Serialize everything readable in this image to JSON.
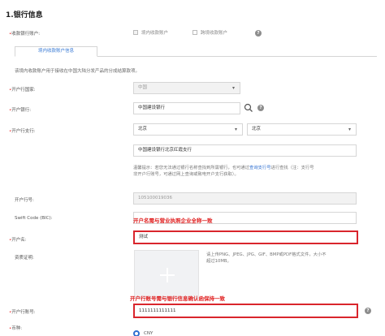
{
  "section_title": "1.银行信息",
  "account_type": {
    "label": "收款银行账户:",
    "option1": "境内收款账户",
    "option2": "跨境收款账户"
  },
  "tab": {
    "label": "境内收款账户信息"
  },
  "intro": "该境内收款账户用于接收在中国大陆分发产品的分成结算款项。",
  "country": {
    "label": "开户行国家:",
    "value": "中国"
  },
  "bank": {
    "label": "开户银行:",
    "value": "中国建设银行"
  },
  "branch": {
    "label": "开户行支行:",
    "province": "北京",
    "city": "北京",
    "value": "中国建设银行北京红霞支行",
    "tip_line1_a": "温馨提示：若您无法通过银行名称查找到所需银行，也可通过",
    "tip_link": "查询支行号",
    "tip_line1_b": "进行查找（注：支行号",
    "tip_line2": "非开户行账号，可通过网上查询或致电开户支行获取）。"
  },
  "bank_code": {
    "label": "开户行号:",
    "value": "105100019036"
  },
  "swift": {
    "label": "Swift Code (BIC):",
    "note": "开户名需与营业执照企业全称一致"
  },
  "account_name": {
    "label": "开户名:",
    "value": "测试"
  },
  "license": {
    "label": "资质证明:",
    "hint_line1": "请上传PNG、JPEG、JPG、GIF、BMP或PDF格式文件，大小不",
    "hint_line2": "超过10MB。"
  },
  "account_number": {
    "label": "开户行账号:",
    "value": "1111111111111",
    "note": "开户行账号需与银行信息确认函保持一致"
  },
  "currency": {
    "label": "币种:",
    "value": "CNY"
  }
}
